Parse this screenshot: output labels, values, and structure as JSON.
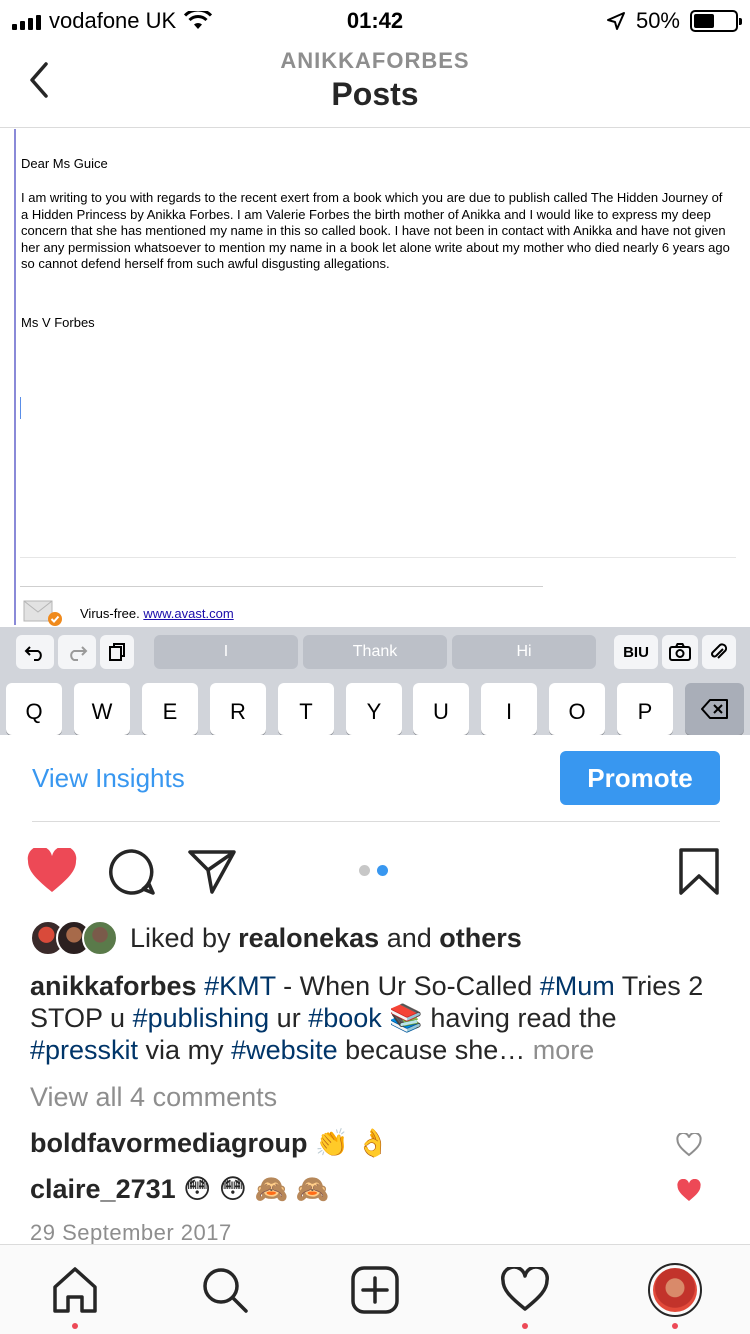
{
  "status_bar": {
    "carrier": "vodafone UK",
    "time": "01:42",
    "battery": "50%",
    "battery_level": 0.5
  },
  "header": {
    "username": "ANIKKAFORBES",
    "title": "Posts"
  },
  "post_image": {
    "greeting": "Dear Ms Guice",
    "body": "I am writing to you with regards to the recent exert from a book which you are due to publish called The Hidden Journey of a Hidden Princess by Anikka Forbes.  I am Valerie Forbes the birth mother of Anikka and I would like to express my deep concern that she has mentioned my name in this so called book.  I have not been in contact with Anikka and have not given her any permission whatsoever to mention my name in a book let alone write about my mother who died nearly 6 years ago so cannot defend herself from such awful disgusting allegations.",
    "signature": "Ms V Forbes",
    "virus_free": "Virus-free.",
    "virus_link": "www.avast.com",
    "keyboard": {
      "suggestions": [
        "I",
        "Thank",
        "Hi"
      ],
      "format_label": "BIU",
      "keys": [
        "Q",
        "W",
        "E",
        "R",
        "T",
        "Y",
        "U",
        "I",
        "O",
        "P"
      ]
    }
  },
  "insights": {
    "view_label": "View Insights",
    "promote_label": "Promote"
  },
  "actions": {
    "carousel_total": 2,
    "carousel_active": 2
  },
  "likes": {
    "prefix": "Liked by",
    "user": "realonekas",
    "and": "and",
    "others": "others"
  },
  "caption": {
    "user": "anikkaforbes",
    "tag_kmt": "#KMT",
    "t1": " - When Ur So-Called ",
    "tag_mum": "#Mum",
    "t2": " Tries 2 STOP u ",
    "tag_publishing": "#publishing",
    "t3": " ur ",
    "tag_book": "#book",
    "t4": " 📚 having read the ",
    "tag_presskit": "#presskit",
    "t5": " via my ",
    "tag_website": "#website",
    "t6": " because she… ",
    "more": "more"
  },
  "comments": {
    "view_all": "View all 4 comments",
    "items": [
      {
        "user": "boldfavormediagroup",
        "text": "👏 👌",
        "liked": false
      },
      {
        "user": "claire_2731",
        "text": "😳 😳 🙈 🙈",
        "liked": true
      }
    ]
  },
  "date": "29 September 2017",
  "colors": {
    "accent": "#3897f0",
    "heart": "#ed4956",
    "hashtag": "#003569"
  }
}
